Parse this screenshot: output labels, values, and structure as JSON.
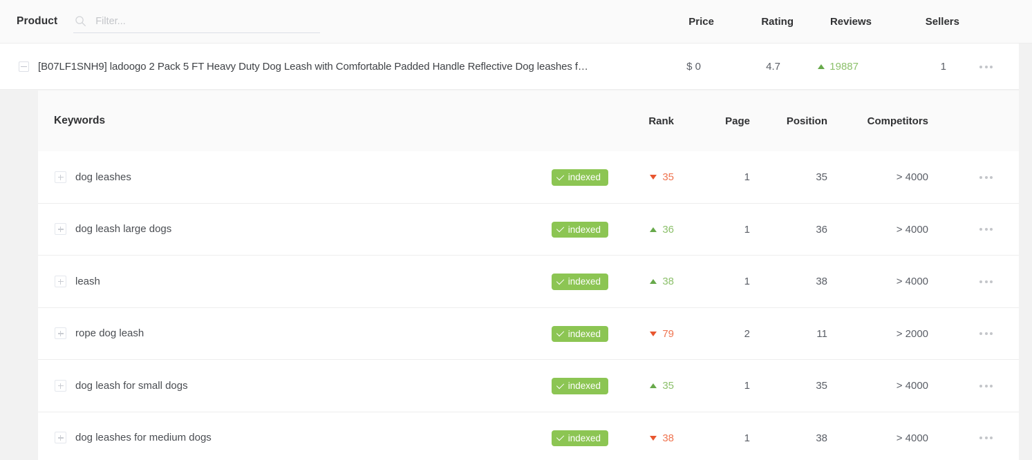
{
  "product_table": {
    "title": "Product",
    "filter": {
      "placeholder": "Filter...",
      "value": ""
    },
    "columns": {
      "price": "Price",
      "rating": "Rating",
      "reviews": "Reviews",
      "sellers": "Sellers"
    },
    "row": {
      "title": "[B07LF1SNH9] ladoogo 2 Pack 5 FT Heavy Duty Dog Leash with Comfortable Padded Handle Reflective Dog leashes f…",
      "price": "$ 0",
      "rating": "4.7",
      "reviews": "19887",
      "reviews_trend": "up",
      "sellers": "1"
    }
  },
  "keywords_table": {
    "title": "Keywords",
    "columns": {
      "rank": "Rank",
      "page": "Page",
      "position": "Position",
      "competitors": "Competitors"
    },
    "rows": [
      {
        "keyword": "dog leashes",
        "status": "indexed",
        "rank": "35",
        "trend": "down",
        "page": "1",
        "position": "35",
        "competitors": "> 4000"
      },
      {
        "keyword": "dog leash large dogs",
        "status": "indexed",
        "rank": "36",
        "trend": "up",
        "page": "1",
        "position": "36",
        "competitors": "> 4000"
      },
      {
        "keyword": "leash",
        "status": "indexed",
        "rank": "38",
        "trend": "up",
        "page": "1",
        "position": "38",
        "competitors": "> 4000"
      },
      {
        "keyword": "rope dog leash",
        "status": "indexed",
        "rank": "79",
        "trend": "down",
        "page": "2",
        "position": "11",
        "competitors": "> 2000"
      },
      {
        "keyword": "dog leash for small dogs",
        "status": "indexed",
        "rank": "35",
        "trend": "up",
        "page": "1",
        "position": "35",
        "competitors": "> 4000"
      },
      {
        "keyword": "dog leashes for medium dogs",
        "status": "indexed",
        "rank": "38",
        "trend": "down",
        "page": "1",
        "position": "38",
        "competitors": "> 4000"
      }
    ]
  },
  "colors": {
    "badge_green": "#8cc553",
    "trend_up": "#8cc06b",
    "trend_down": "#ef7450",
    "header_bg": "#fafafa",
    "row_bg": "#ffffff"
  }
}
